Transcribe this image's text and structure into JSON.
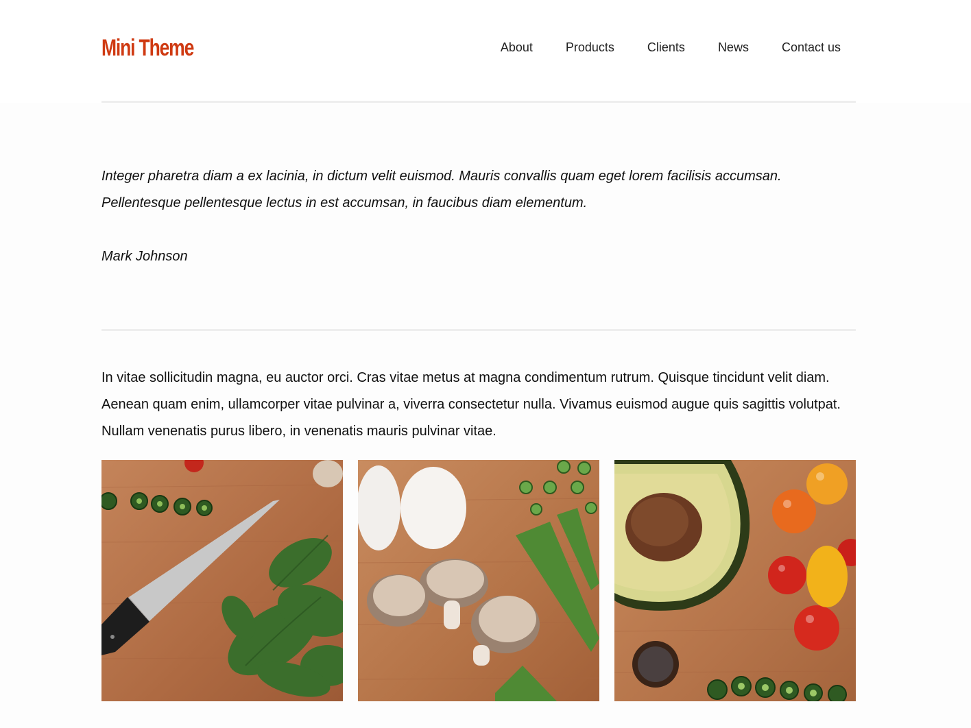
{
  "header": {
    "logo": "Mini Theme",
    "nav": [
      "About",
      "Products",
      "Clients",
      "News",
      "Contact us"
    ]
  },
  "testimonial": {
    "quote": "Integer pharetra diam a ex lacinia, in dictum velit euismod. Mauris convallis quam eget lorem facilisis accumsan. Pellentesque pellentesque lectus in est accumsan, in faucibus diam elementum.",
    "author": "Mark Johnson"
  },
  "content": {
    "paragraph": "In vitae sollicitudin magna, eu auctor orci. Cras vitae metus at magna condimentum rutrum. Quisque tincidunt velit diam. Aenean quam enim, ullamcorper vitae pulvinar a, viverra consectetur nulla. Vivamus euismod augue quis sagittis volutpat. Nullam venenatis purus libero, in venenatis mauris pulvinar vitae."
  },
  "gallery": {
    "images": [
      "knife-spinach-photo",
      "eggs-mushrooms-photo",
      "avocado-tomatoes-photo"
    ]
  },
  "colors": {
    "brand": "#cf3a12",
    "text": "#111111",
    "divider": "#eeeeee",
    "wood": "#b9754a"
  }
}
